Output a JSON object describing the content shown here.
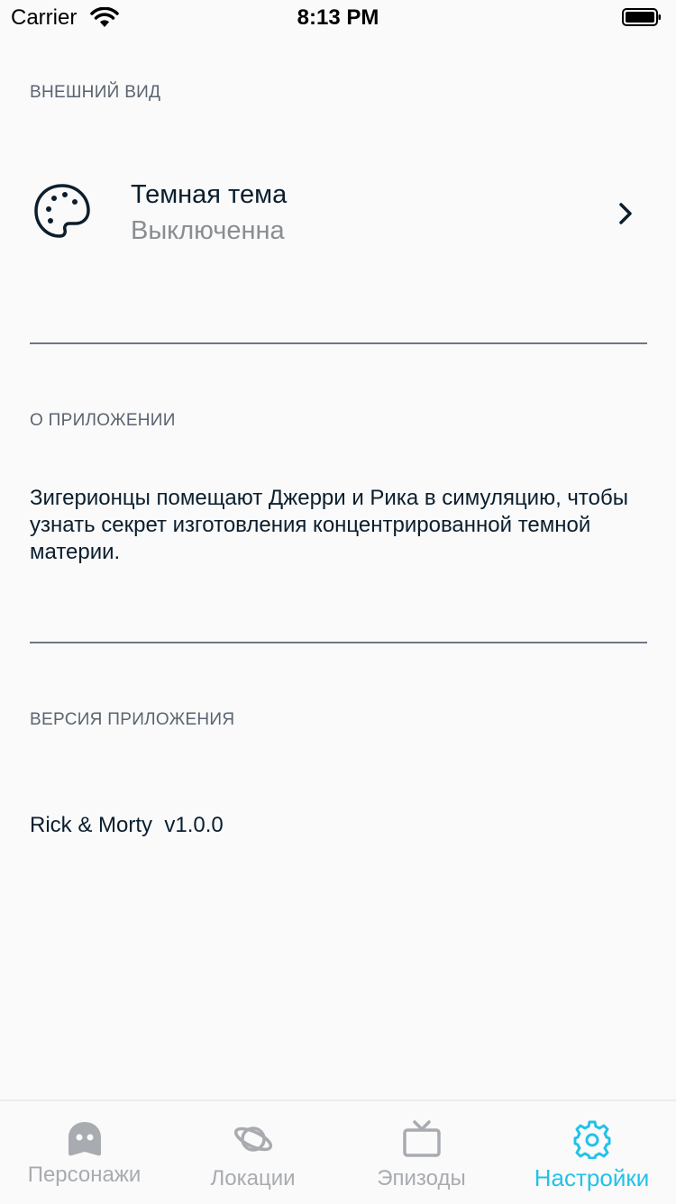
{
  "status_bar": {
    "carrier": "Carrier",
    "time": "8:13 PM"
  },
  "appearance": {
    "header": "ВНЕШНИЙ ВИД",
    "theme_title": "Темная тема",
    "theme_value": "Выключенна"
  },
  "about": {
    "header": "О ПРИЛОЖЕНИИ",
    "text": "Зигерионцы помещают Джерри и Рика в симуляцию, чтобы узнать секрет изготовления концентрированной темной материи."
  },
  "version": {
    "header": "ВЕРСИЯ ПРИЛОЖЕНИЯ",
    "text": "Rick & Morty  v1.0.0"
  },
  "tabs": [
    {
      "label": "Персонажи",
      "icon": "ghost-icon"
    },
    {
      "label": "Локации",
      "icon": "planet-icon"
    },
    {
      "label": "Эпизоды",
      "icon": "tv-icon"
    },
    {
      "label": "Настройки",
      "icon": "gear-icon",
      "active": true
    }
  ],
  "colors": {
    "accent": "#22c2e8",
    "inactive": "#a8abaf",
    "text": "#0b1e2d",
    "background": "#fafafa"
  }
}
